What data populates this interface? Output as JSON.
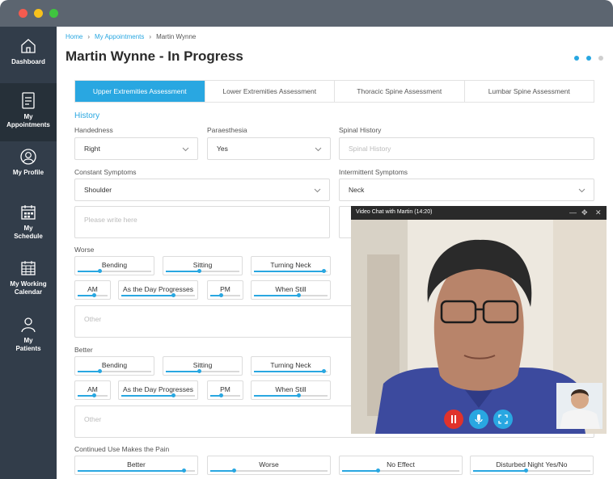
{
  "window_dots": {
    "red": "#f45b4f",
    "yellow": "#f7c11c",
    "green": "#3fc43f"
  },
  "sidebar": {
    "items": [
      {
        "label": "Dashboard",
        "icon": "house-icon"
      },
      {
        "label": "My Appointments",
        "icon": "clipboard-icon"
      },
      {
        "label": "My Profile",
        "icon": "person-circle-icon"
      },
      {
        "label": "My Schedule",
        "icon": "calendar-grid-icon"
      },
      {
        "label": "My Working Calendar",
        "icon": "calendar-icon"
      },
      {
        "label": "My Patients",
        "icon": "people-icon"
      }
    ]
  },
  "breadcrumb": {
    "home": "Home",
    "appointments": "My Appointments",
    "current": "Martin Wynne"
  },
  "page_title": "Martin Wynne - In Progress",
  "tabs": [
    {
      "label": "Upper Extremities Assessment",
      "active": true
    },
    {
      "label": "Lower Extremities Assessment",
      "active": false
    },
    {
      "label": "Thoracic Spine Assessment",
      "active": false
    },
    {
      "label": "Lumbar Spine Assessment",
      "active": false
    }
  ],
  "history": {
    "heading": "History",
    "handedness": {
      "label": "Handedness",
      "value": "Right"
    },
    "paraesthesia": {
      "label": "Paraesthesia",
      "value": "Yes"
    },
    "spinal_history": {
      "label": "Spinal History",
      "placeholder": "Spinal History"
    },
    "constant": {
      "label": "Constant Symptoms",
      "value": "Shoulder"
    },
    "intermittent": {
      "label": "Intermittent Symptoms",
      "value": "Neck"
    },
    "notes_placeholder": "Please write here"
  },
  "worse": {
    "label": "Worse",
    "row1": [
      {
        "label": "Bending",
        "level": 0.3
      },
      {
        "label": "Sitting",
        "level": 0.45
      },
      {
        "label": "Turning Neck",
        "level": 0.95
      }
    ],
    "row2": [
      {
        "label": "AM",
        "level": 0.55
      },
      {
        "label": "As the Day Progresses",
        "level": 0.7
      },
      {
        "label": "PM",
        "level": 0.35
      },
      {
        "label": "When Still",
        "level": 0.6
      }
    ],
    "other_placeholder": "Other"
  },
  "better": {
    "label": "Better",
    "row1": [
      {
        "label": "Bending",
        "level": 0.3
      },
      {
        "label": "Sitting",
        "level": 0.45
      },
      {
        "label": "Turning Neck",
        "level": 0.95
      }
    ],
    "row2": [
      {
        "label": "AM",
        "level": 0.55
      },
      {
        "label": "As the Day Progresses",
        "level": 0.7
      },
      {
        "label": "PM",
        "level": 0.35
      },
      {
        "label": "When Still",
        "level": 0.6
      }
    ],
    "other_placeholder": "Other"
  },
  "continued": {
    "label": "Continued Use Makes the Pain",
    "items": [
      {
        "label": "Better",
        "level": 0.9
      },
      {
        "label": "Worse",
        "level": 0.2
      },
      {
        "label": "No Effect",
        "level": 0.3
      },
      {
        "label": "Disturbed Night Yes/No",
        "level": 0.45
      }
    ]
  },
  "video_chat": {
    "title": "Video Chat with Martin (14:20)"
  },
  "colors": {
    "accent": "#29a7e1",
    "sidebar": "#323d4a",
    "end_call": "#e0322b"
  }
}
